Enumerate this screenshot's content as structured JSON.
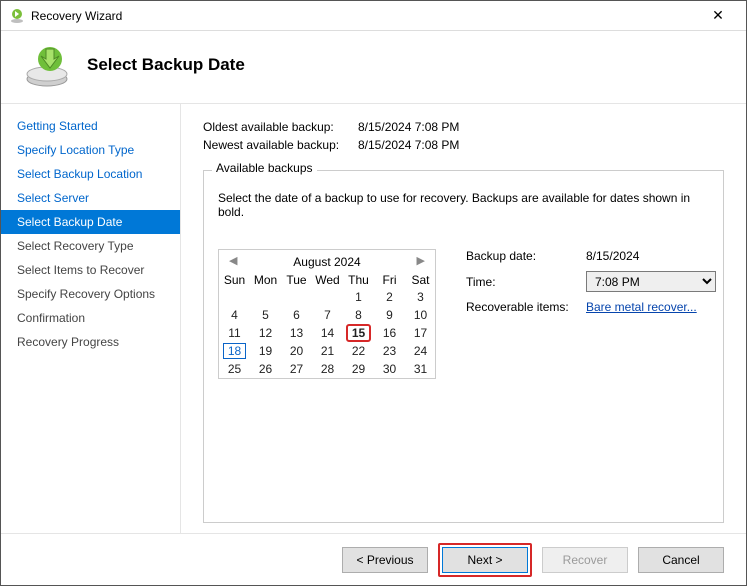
{
  "window": {
    "title": "Recovery Wizard"
  },
  "header": {
    "title": "Select Backup Date"
  },
  "sidebar": {
    "items": [
      {
        "label": "Getting Started",
        "state": "done"
      },
      {
        "label": "Specify Location Type",
        "state": "done"
      },
      {
        "label": "Select Backup Location",
        "state": "done"
      },
      {
        "label": "Select Server",
        "state": "done"
      },
      {
        "label": "Select Backup Date",
        "state": "selected"
      },
      {
        "label": "Select Recovery Type",
        "state": "pending"
      },
      {
        "label": "Select Items to Recover",
        "state": "pending"
      },
      {
        "label": "Specify Recovery Options",
        "state": "pending"
      },
      {
        "label": "Confirmation",
        "state": "pending"
      },
      {
        "label": "Recovery Progress",
        "state": "pending"
      }
    ]
  },
  "info": {
    "oldest_label": "Oldest available backup:",
    "oldest_value": "8/15/2024 7:08 PM",
    "newest_label": "Newest available backup:",
    "newest_value": "8/15/2024 7:08 PM"
  },
  "group": {
    "legend": "Available backups",
    "hint": "Select the date of a backup to use for recovery. Backups are available for dates shown in bold."
  },
  "calendar": {
    "month_label": "August 2024",
    "weekdays": [
      "Sun",
      "Mon",
      "Tue",
      "Wed",
      "Thu",
      "Fri",
      "Sat"
    ],
    "weeks": [
      [
        "",
        "",
        "",
        "",
        "1",
        "2",
        "3"
      ],
      [
        "4",
        "5",
        "6",
        "7",
        "8",
        "9",
        "10"
      ],
      [
        "11",
        "12",
        "13",
        "14",
        "15",
        "16",
        "17"
      ],
      [
        "18",
        "19",
        "20",
        "21",
        "22",
        "23",
        "24"
      ],
      [
        "25",
        "26",
        "27",
        "28",
        "29",
        "30",
        "31"
      ]
    ],
    "selected_day": "15",
    "today": "18",
    "bold_days": [
      "15"
    ]
  },
  "details": {
    "backup_date_label": "Backup date:",
    "backup_date_value": "8/15/2024",
    "time_label": "Time:",
    "time_value": "7:08 PM",
    "recoverable_label": "Recoverable items:",
    "recoverable_link": "Bare metal recover..."
  },
  "footer": {
    "previous": "< Previous",
    "next": "Next >",
    "recover": "Recover",
    "cancel": "Cancel"
  }
}
